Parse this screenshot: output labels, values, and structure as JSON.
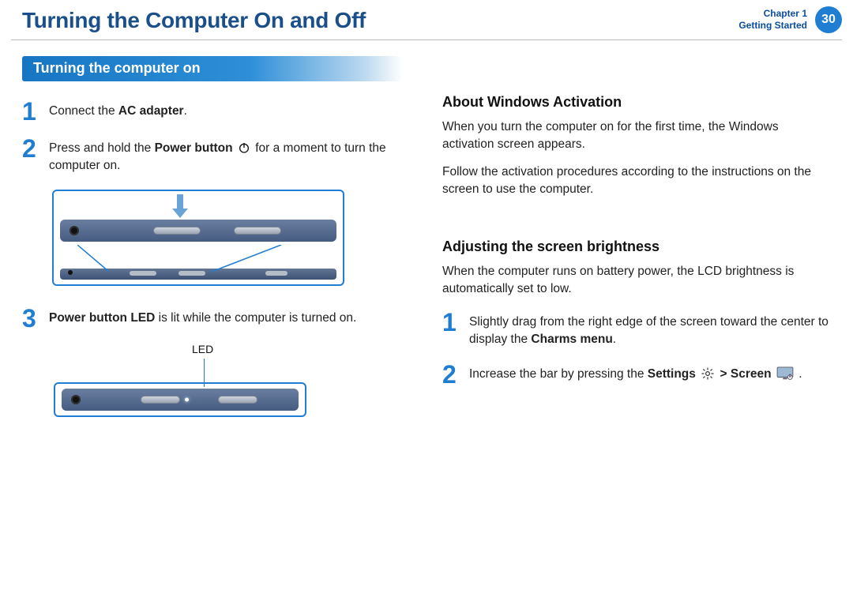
{
  "header": {
    "title": "Turning the Computer On and Off",
    "chapter_line1": "Chapter 1",
    "chapter_line2": "Getting Started",
    "page_number": "30"
  },
  "left": {
    "section_title": "Turning the computer on",
    "step1_num": "1",
    "step1_pre": "Connect the ",
    "step1_bold": "AC adapter",
    "step1_post": ".",
    "step2_num": "2",
    "step2_pre": "Press and hold the ",
    "step2_bold": "Power button",
    "step2_post": " for a moment to turn the computer on.",
    "step3_num": "3",
    "step3_bold": "Power button LED",
    "step3_post": " is lit while the computer is turned on.",
    "fig2_label": "LED"
  },
  "right": {
    "h1": "About Windows Activation",
    "p1": "When you turn the computer on for the first time, the Windows activation screen appears.",
    "p2": "Follow the activation procedures according to the instructions on the screen to use the computer.",
    "h2": "Adjusting the screen brightness",
    "p3": "When the computer runs on battery power, the LCD brightness is automatically set to low.",
    "step1_num": "1",
    "step1_pre": "Slightly drag from the right edge of the screen toward the center to display the ",
    "step1_bold": "Charms menu",
    "step1_post": ".",
    "step2_num": "2",
    "step2_pre": "Increase the bar by pressing the ",
    "step2_bold1": "Settings",
    "step2_mid": " > ",
    "step2_bold2": "Screen",
    "step2_post": " ."
  }
}
